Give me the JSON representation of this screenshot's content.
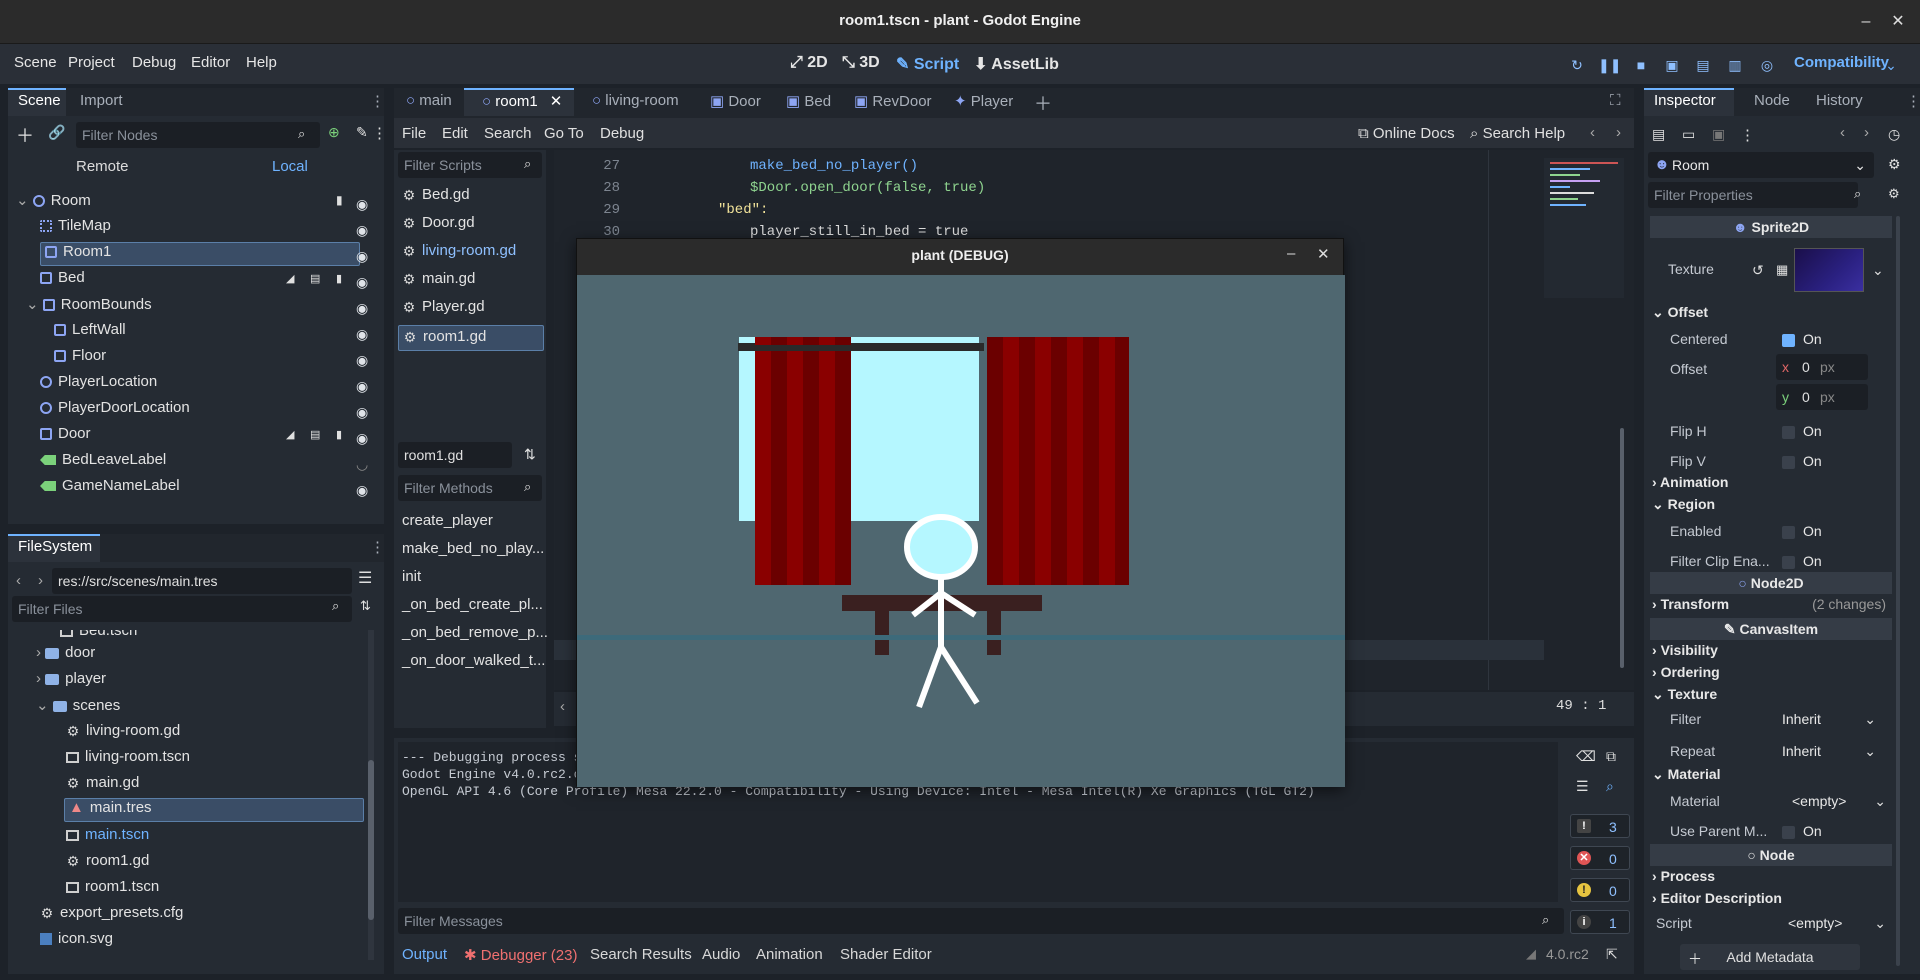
{
  "window": {
    "title": "room1.tscn - plant - Godot Engine"
  },
  "menu": {
    "scene": "Scene",
    "project": "Project",
    "debug": "Debug",
    "editor": "Editor",
    "help": "Help"
  },
  "workspaces": {
    "w2d": "2D",
    "w3d": "3D",
    "script": "Script",
    "assetlib": "AssetLib"
  },
  "renderer": "Compatibility",
  "scene_dock": {
    "tabs": [
      "Scene",
      "Import"
    ],
    "filter_placeholder": "Filter Nodes",
    "remote": "Remote",
    "local": "Local",
    "nodes": [
      "Room",
      "TileMap",
      "Room1",
      "Bed",
      "RoomBounds",
      "LeftWall",
      "Floor",
      "PlayerLocation",
      "PlayerDoorLocation",
      "Door",
      "BedLeaveLabel",
      "GameNameLabel"
    ]
  },
  "filesystem": {
    "tab": "FileSystem",
    "path": "res://src/scenes/main.tres",
    "filter_placeholder": "Filter Files",
    "items": [
      "Bed.tscn",
      "door",
      "player",
      "scenes",
      "living-room.gd",
      "living-room.tscn",
      "main.gd",
      "main.tres",
      "main.tscn",
      "room1.gd",
      "room1.tscn",
      "export_presets.cfg",
      "icon.svg"
    ]
  },
  "editor_tabs": [
    "main",
    "room1",
    "living-room",
    "Door",
    "Bed",
    "RevDoor",
    "Player"
  ],
  "script_menu": {
    "file": "File",
    "edit": "Edit",
    "search": "Search",
    "goto": "Go To",
    "debug": "Debug",
    "online_docs": "Online Docs",
    "search_help": "Search Help"
  },
  "scripts": {
    "filter_placeholder": "Filter Scripts",
    "list": [
      "Bed.gd",
      "Door.gd",
      "living-room.gd",
      "main.gd",
      "Player.gd",
      "room1.gd"
    ],
    "current": "room1.gd",
    "methods_placeholder": "Filter Methods",
    "methods": [
      "create_player",
      "make_bed_no_play...",
      "init",
      "_on_bed_create_pl...",
      "_on_bed_remove_p...",
      "_on_door_walked_t..."
    ]
  },
  "code": {
    "lines": [
      {
        "n": "27",
        "t": "make_bed_no_player()"
      },
      {
        "n": "28",
        "t": "$Door.open_door(false, true)"
      },
      {
        "n": "29",
        "t": "\"bed\":"
      },
      {
        "n": "30",
        "t": "player_still_in_bed = true"
      }
    ],
    "cursor": "49 :   1"
  },
  "game_window": {
    "title": "plant (DEBUG)"
  },
  "output": {
    "lines": [
      "--- Debugging process s",
      "Godot Engine v4.0.rc2.o",
      "OpenGL API 4.6 (Core Profile) Mesa 22.2.0 - Compatibility - Using Device: Intel - Mesa Intel(R) Xe Graphics (TGL GT2)"
    ],
    "filter_placeholder": "Filter Messages",
    "counts": {
      "all": "3",
      "errors": "0",
      "warnings": "0",
      "info": "1"
    }
  },
  "bottom_tabs": [
    "Output",
    "Debugger (23)",
    "Search Results",
    "Audio",
    "Animation",
    "Shader Editor"
  ],
  "version": "4.0.rc2",
  "inspector": {
    "tabs": [
      "Inspector",
      "Node",
      "History"
    ],
    "object": "Room",
    "filter_placeholder": "Filter Properties",
    "sprite2d": "Sprite2D",
    "texture_label": "Texture",
    "offset_section": "Offset",
    "centered": "Centered",
    "on": "On",
    "offset_label": "Offset",
    "x": "x",
    "y": "y",
    "zero": "0",
    "px": "px",
    "flip_h": "Flip H",
    "flip_v": "Flip V",
    "animation": "Animation",
    "region": "Region",
    "enabled": "Enabled",
    "filter_clip": "Filter Clip Ena...",
    "node2d": "Node2D",
    "transform": "Transform",
    "transform_changes": "(2 changes)",
    "canvasitem": "CanvasItem",
    "visibility": "Visibility",
    "ordering": "Ordering",
    "texture_section": "Texture",
    "filter": "Filter",
    "repeat": "Repeat",
    "inherit": "Inherit",
    "material_section": "Material",
    "material": "Material",
    "empty": "<empty>",
    "use_parent": "Use Parent M...",
    "node": "Node",
    "process": "Process",
    "editor_description": "Editor Description",
    "script": "Script",
    "add_metadata": "Add Metadata"
  }
}
